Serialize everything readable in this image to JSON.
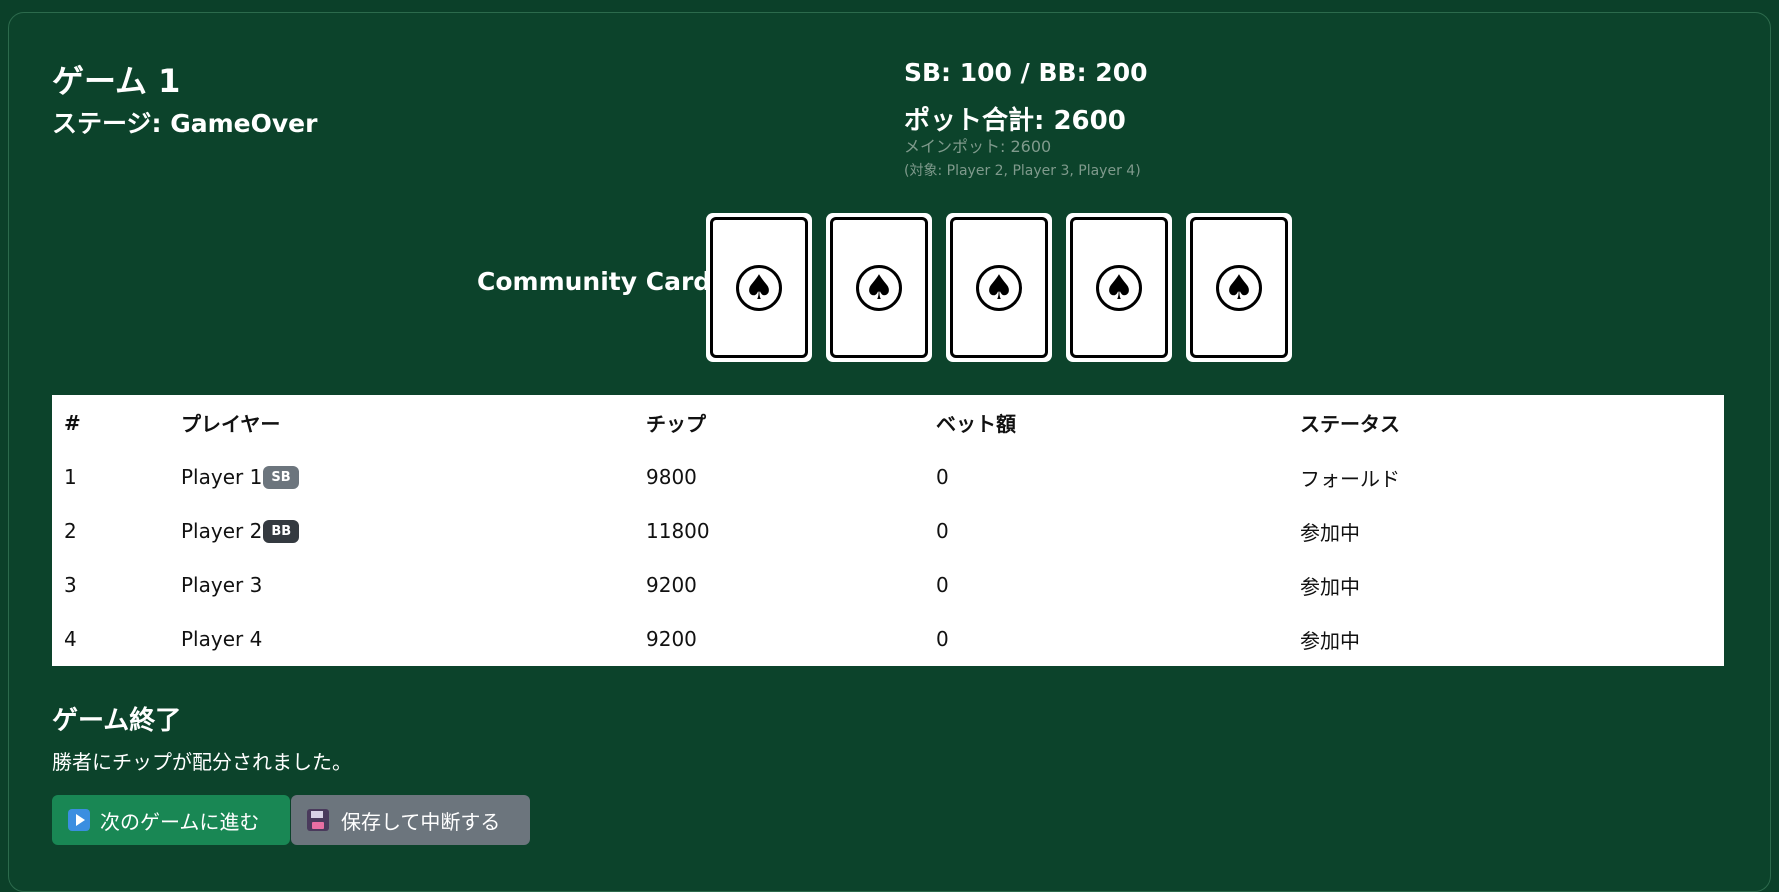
{
  "header": {
    "game_title": "ゲーム 1",
    "stage": "ステージ: GameOver",
    "blinds": "SB: 100 / BB: 200",
    "pot_total": "ポット合計: 2600",
    "main_pot": "メインポット: 2600",
    "pot_targets": "(対象: Player 2, Player 3, Player 4)"
  },
  "community": {
    "label": "Community Cards:",
    "cards": [
      {
        "glyph": "♠",
        "icon": "spade-icon"
      },
      {
        "glyph": "♠",
        "icon": "spade-icon"
      },
      {
        "glyph": "♠",
        "icon": "spade-icon"
      },
      {
        "glyph": "♠",
        "icon": "spade-icon"
      },
      {
        "glyph": "♠",
        "icon": "spade-icon"
      }
    ]
  },
  "players_table": {
    "headers": [
      "#",
      "プレイヤー",
      "チップ",
      "ベット額",
      "ステータス"
    ],
    "rows": [
      {
        "num": "1",
        "player": "Player 1",
        "badge": "SB",
        "chips": "9800",
        "bet": "0",
        "status": "フォールド"
      },
      {
        "num": "2",
        "player": "Player 2",
        "badge": "BB",
        "chips": "11800",
        "bet": "0",
        "status": "参加中"
      },
      {
        "num": "3",
        "player": "Player 3",
        "badge": "",
        "chips": "9200",
        "bet": "0",
        "status": "参加中"
      },
      {
        "num": "4",
        "player": "Player 4",
        "badge": "",
        "chips": "9200",
        "bet": "0",
        "status": "参加中"
      }
    ]
  },
  "game_over": {
    "title": "ゲーム終了",
    "message": "勝者にチップが配分されました。"
  },
  "actions": {
    "next_label": "次のゲームに進む",
    "next_icon": "play-icon",
    "save_label": "保存して中断する",
    "save_icon": "floppy-disk-icon"
  },
  "colors": {
    "background": "#0b4029",
    "next_button": "#198754",
    "save_button": "#6c757d",
    "badge_sb": "#6c757d",
    "badge_bb": "#343a40"
  }
}
